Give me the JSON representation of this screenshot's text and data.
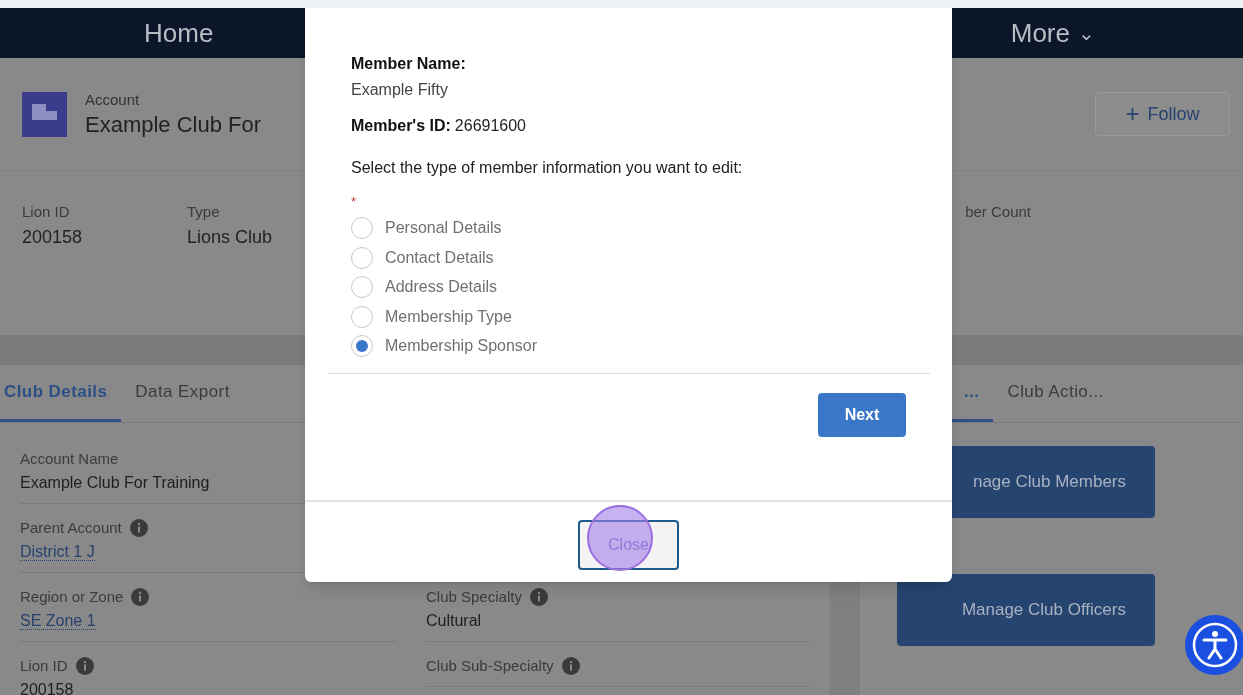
{
  "nav": {
    "home": "Home",
    "more": "More",
    "more_caret": "⌄"
  },
  "header": {
    "object_label": "Account",
    "record_name": "Example Club For",
    "follow": {
      "plus": "+",
      "label": "Follow"
    }
  },
  "highlights": [
    {
      "label": "Lion ID",
      "value": "200158"
    },
    {
      "label": "Type",
      "value": "Lions Club"
    }
  ],
  "highlights_right": {
    "label": "ber Count"
  },
  "left_tabs": [
    {
      "label": "Club Details",
      "selected": true
    },
    {
      "label": "Data Export",
      "selected": false
    }
  ],
  "right_tabs": [
    {
      "label": "...",
      "selected": true
    },
    {
      "label": "Club Actio...",
      "selected": false
    }
  ],
  "fields_left": [
    {
      "label": "Account Name",
      "value": "Example Club For Training",
      "info": false,
      "link": false
    },
    {
      "label": "Parent Account",
      "value": "District 1 J",
      "info": true,
      "link": true
    },
    {
      "label": "Region or Zone",
      "value": "SE Zone 1",
      "info": true,
      "link": true
    },
    {
      "label": "Lion ID",
      "value": "200158",
      "info": true,
      "link": false
    }
  ],
  "fields_middle": [
    {
      "label": "Club Specialty",
      "value": "Cultural",
      "info": true
    },
    {
      "label": "Club Sub-Specialty",
      "info": true
    }
  ],
  "actions": [
    "nage Club Members",
    "Manage Club Officers"
  ],
  "modal": {
    "name_label": "Member Name:",
    "name_value": "Example Fifty",
    "id_label": "Member's ID:",
    "id_value": "26691600",
    "prompt": "Select the type of member information you want to edit:",
    "required_mark": "*",
    "options": [
      {
        "label": "Personal Details",
        "selected": false
      },
      {
        "label": "Contact Details",
        "selected": false
      },
      {
        "label": "Address Details",
        "selected": false
      },
      {
        "label": "Membership Type",
        "selected": false
      },
      {
        "label": "Membership Sponsor",
        "selected": true
      }
    ],
    "next": "Next",
    "close": "Close"
  }
}
